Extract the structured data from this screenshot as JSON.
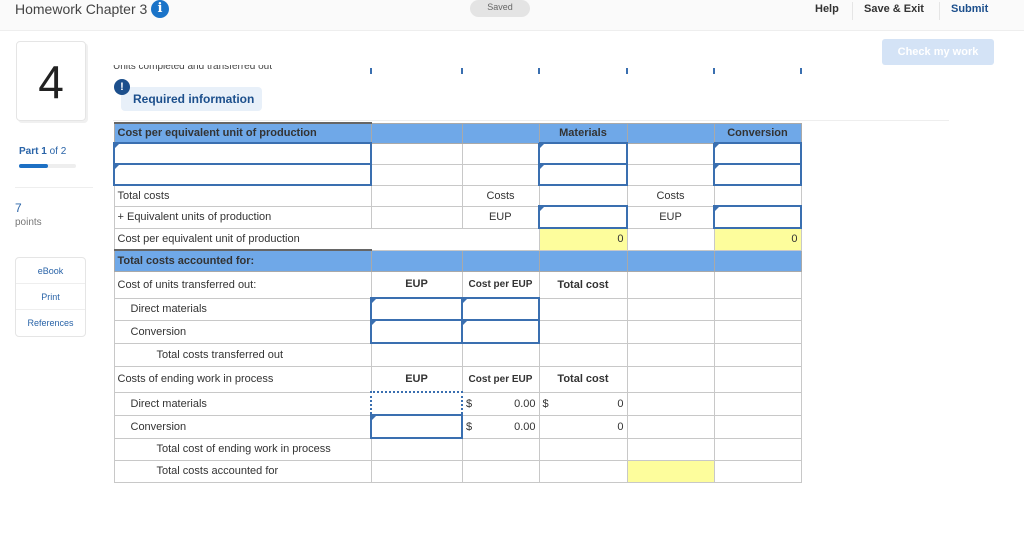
{
  "header": {
    "title": "Homework Chapter 3",
    "saved": "Saved",
    "help": "Help",
    "save_exit": "Save & Exit",
    "submit": "Submit",
    "check": "Check my work"
  },
  "question": {
    "number": "4",
    "part_label": "Part",
    "part_num": "1",
    "part_of": "of 2",
    "part_progress": 0.5,
    "points": "7",
    "points_label": "points",
    "cut_text": "Units completed and transferred out",
    "required": "Required information"
  },
  "sidebar": {
    "items": [
      "eBook",
      "Print",
      "References"
    ]
  },
  "colors": {
    "accent": "#6fa8e8",
    "highlight": "#fdfd9c",
    "brand": "#1d70c4"
  },
  "table": {
    "rows": [
      {
        "cls": "blue",
        "h": 20,
        "cells": [
          {
            "v": "Cost per equivalent unit of production",
            "k": "b"
          },
          {},
          {},
          {
            "v": "Materials",
            "k": "b c"
          },
          {},
          {
            "v": "Conversion",
            "k": "b c"
          }
        ]
      },
      {
        "h": 21,
        "cells": [
          {
            "k": "in"
          },
          {},
          {},
          {
            "k": "in"
          },
          {},
          {
            "k": "in"
          }
        ]
      },
      {
        "h": 21,
        "cells": [
          {
            "k": "in"
          },
          {},
          {},
          {
            "k": "in"
          },
          {},
          {
            "k": "in"
          }
        ]
      },
      {
        "h": 21,
        "cells": [
          {
            "v": "Total costs"
          },
          {},
          {
            "v": "Costs",
            "k": "c"
          },
          {},
          {
            "v": "Costs",
            "k": "c"
          },
          {}
        ]
      },
      {
        "h": 22,
        "cells": [
          {
            "v": "+ Equivalent units of production"
          },
          {},
          {
            "v": "EUP",
            "k": "c"
          },
          {
            "k": "in"
          },
          {
            "v": "EUP",
            "k": "c"
          },
          {
            "k": "in"
          }
        ]
      },
      {
        "h": 22,
        "cells": [
          {
            "v": "Cost per equivalent unit of production",
            "span": 3
          },
          {
            "v": "0",
            "k": "y r"
          },
          {},
          {
            "v": "0",
            "k": "y r"
          }
        ]
      },
      {
        "cls": "blue",
        "h": 21,
        "cells": [
          {
            "v": "Total costs accounted for:",
            "k": "b"
          },
          {},
          {},
          {},
          {},
          {}
        ]
      },
      {
        "h": 27,
        "cells": [
          {
            "v": "Cost of units transferred out:"
          },
          {
            "v": "EUP",
            "k": "b c"
          },
          {
            "v": "Cost per EUP",
            "k": "b c small"
          },
          {
            "v": "Total cost",
            "k": "b c"
          },
          {},
          {}
        ]
      },
      {
        "h": 22,
        "cells": [
          {
            "v": "Direct materials",
            "k": "i1"
          },
          {
            "k": "in"
          },
          {
            "k": "in"
          },
          {},
          {},
          {}
        ]
      },
      {
        "h": 23,
        "cells": [
          {
            "v": "Conversion",
            "k": "i1"
          },
          {
            "k": "in"
          },
          {
            "k": "in"
          },
          {},
          {},
          {}
        ]
      },
      {
        "h": 23,
        "cells": [
          {
            "v": "Total costs transferred out",
            "k": "i2"
          },
          {},
          {},
          {},
          {},
          {}
        ]
      },
      {
        "h": 26,
        "cells": [
          {
            "v": "Costs of ending work in process"
          },
          {
            "v": "EUP",
            "k": "b c"
          },
          {
            "v": "Cost per EUP",
            "k": "b c small"
          },
          {
            "v": "Total cost",
            "k": "b c"
          },
          {},
          {}
        ]
      },
      {
        "h": 23,
        "cells": [
          {
            "v": "Direct materials",
            "k": "i1"
          },
          {
            "k": "dot"
          },
          {
            "v": "0.00",
            "cur": "$",
            "k": "r"
          },
          {
            "v": "0",
            "cur": "$",
            "k": "r"
          },
          {},
          {}
        ]
      },
      {
        "h": 23,
        "cells": [
          {
            "v": "Conversion",
            "k": "i1"
          },
          {
            "k": "in"
          },
          {
            "v": "0.00",
            "cur": "$",
            "k": "r"
          },
          {
            "v": "0",
            "k": "r"
          },
          {},
          {}
        ]
      },
      {
        "h": 22,
        "cells": [
          {
            "v": "Total cost of ending work in process",
            "k": "i2"
          },
          {},
          {},
          {},
          {},
          {}
        ]
      },
      {
        "h": 22,
        "cells": [
          {
            "v": "Total costs accounted for",
            "k": "i2"
          },
          {},
          {},
          {},
          {
            "k": "y"
          },
          {}
        ]
      }
    ]
  }
}
